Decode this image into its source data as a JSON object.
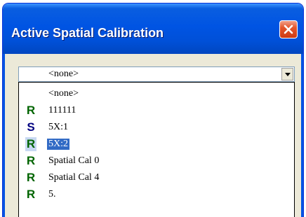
{
  "window": {
    "title": "Active Spatial Calibration"
  },
  "combo": {
    "value": "<none>"
  },
  "dropdown": {
    "items": [
      {
        "badge": "",
        "label": "<none>",
        "badge_type": "none",
        "selected": false
      },
      {
        "badge": "R",
        "label": "111111",
        "badge_type": "R",
        "selected": false
      },
      {
        "badge": "S",
        "label": "5X:1",
        "badge_type": "S",
        "selected": false
      },
      {
        "badge": "R",
        "label": "5X:2",
        "badge_type": "R",
        "selected": true
      },
      {
        "badge": "R",
        "label": "Spatial Cal 0",
        "badge_type": "R",
        "selected": false
      },
      {
        "badge": "R",
        "label": "Spatial Cal 4",
        "badge_type": "R",
        "selected": false
      },
      {
        "badge": "R",
        "label": "5.",
        "badge_type": "R",
        "selected": false
      }
    ]
  },
  "colors": {
    "title_bar": "#0054e3",
    "selection": "#316ac5",
    "badge_R": "#006400",
    "badge_S": "#000080",
    "close_button": "#e3562c"
  },
  "icons": {
    "close": "close-icon",
    "dropdown": "chevron-down-icon"
  }
}
